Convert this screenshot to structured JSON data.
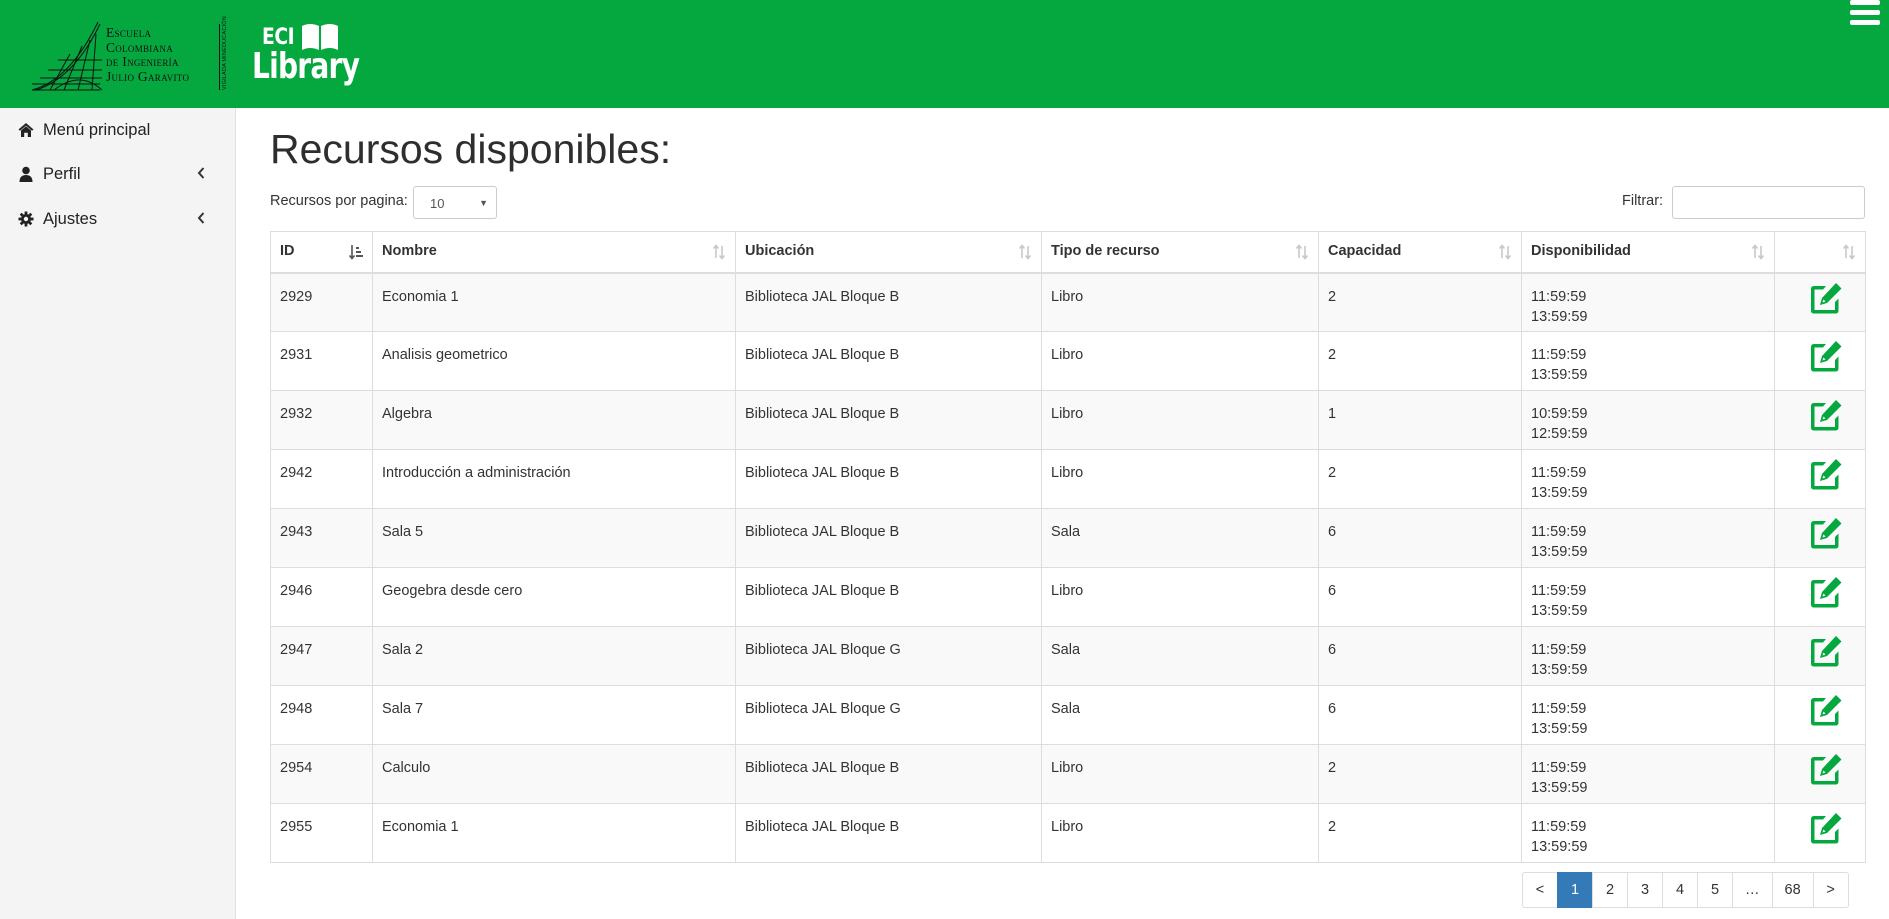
{
  "header": {
    "school_lines": [
      "Escuela",
      "Colombiana",
      "de Ingeniería",
      "Julio Garavito"
    ],
    "school_vertical": "VIGILADA MINEDUCACIÓN",
    "app_small": "ECI",
    "app_big": "Library",
    "brand_color": "#05a83f"
  },
  "sidebar": {
    "items": [
      {
        "label": "Menú principal",
        "icon": "home-icon"
      },
      {
        "label": "Perfil",
        "icon": "user-icon",
        "expandable": true
      },
      {
        "label": "Ajustes",
        "icon": "gear-icon",
        "expandable": true
      }
    ]
  },
  "main": {
    "title": "Recursos disponibles:",
    "per_page_label": "Recursos por pagina:",
    "per_page_value": "10",
    "filter_label": "Filtrar:",
    "filter_value": ""
  },
  "table": {
    "columns": [
      "ID",
      "Nombre",
      "Ubicación",
      "Tipo de recurso",
      "Capacidad",
      "Disponibilidad",
      ""
    ],
    "rows": [
      {
        "id": "2929",
        "nombre": "Economia 1",
        "ubicacion": "Biblioteca JAL Bloque B",
        "tipo": "Libro",
        "capacidad": "2",
        "disp_start": "11:59:59",
        "disp_end": "13:59:59"
      },
      {
        "id": "2931",
        "nombre": "Analisis geometrico",
        "ubicacion": "Biblioteca JAL Bloque B",
        "tipo": "Libro",
        "capacidad": "2",
        "disp_start": "11:59:59",
        "disp_end": "13:59:59"
      },
      {
        "id": "2932",
        "nombre": "Algebra",
        "ubicacion": "Biblioteca JAL Bloque B",
        "tipo": "Libro",
        "capacidad": "1",
        "disp_start": "10:59:59",
        "disp_end": "12:59:59"
      },
      {
        "id": "2942",
        "nombre": "Introducción a administración",
        "ubicacion": "Biblioteca JAL Bloque B",
        "tipo": "Libro",
        "capacidad": "2",
        "disp_start": "11:59:59",
        "disp_end": "13:59:59"
      },
      {
        "id": "2943",
        "nombre": "Sala 5",
        "ubicacion": "Biblioteca JAL Bloque B",
        "tipo": "Sala",
        "capacidad": "6",
        "disp_start": "11:59:59",
        "disp_end": "13:59:59"
      },
      {
        "id": "2946",
        "nombre": "Geogebra desde cero",
        "ubicacion": "Biblioteca JAL Bloque B",
        "tipo": "Libro",
        "capacidad": "6",
        "disp_start": "11:59:59",
        "disp_end": "13:59:59"
      },
      {
        "id": "2947",
        "nombre": "Sala 2",
        "ubicacion": "Biblioteca JAL Bloque G",
        "tipo": "Sala",
        "capacidad": "6",
        "disp_start": "11:59:59",
        "disp_end": "13:59:59"
      },
      {
        "id": "2948",
        "nombre": "Sala 7",
        "ubicacion": "Biblioteca JAL Bloque G",
        "tipo": "Sala",
        "capacidad": "6",
        "disp_start": "11:59:59",
        "disp_end": "13:59:59"
      },
      {
        "id": "2954",
        "nombre": "Calculo",
        "ubicacion": "Biblioteca JAL Bloque B",
        "tipo": "Libro",
        "capacidad": "2",
        "disp_start": "11:59:59",
        "disp_end": "13:59:59"
      },
      {
        "id": "2955",
        "nombre": "Economia 1",
        "ubicacion": "Biblioteca JAL Bloque B",
        "tipo": "Libro",
        "capacidad": "2",
        "disp_start": "11:59:59",
        "disp_end": "13:59:59"
      }
    ],
    "edit_icon": "edit-icon",
    "edit_color": "#05a83f"
  },
  "pagination": {
    "prev": "<",
    "pages": [
      "1",
      "2",
      "3",
      "4",
      "5",
      "…",
      "68"
    ],
    "active": "1",
    "next": ">",
    "active_color": "#337ab7"
  }
}
